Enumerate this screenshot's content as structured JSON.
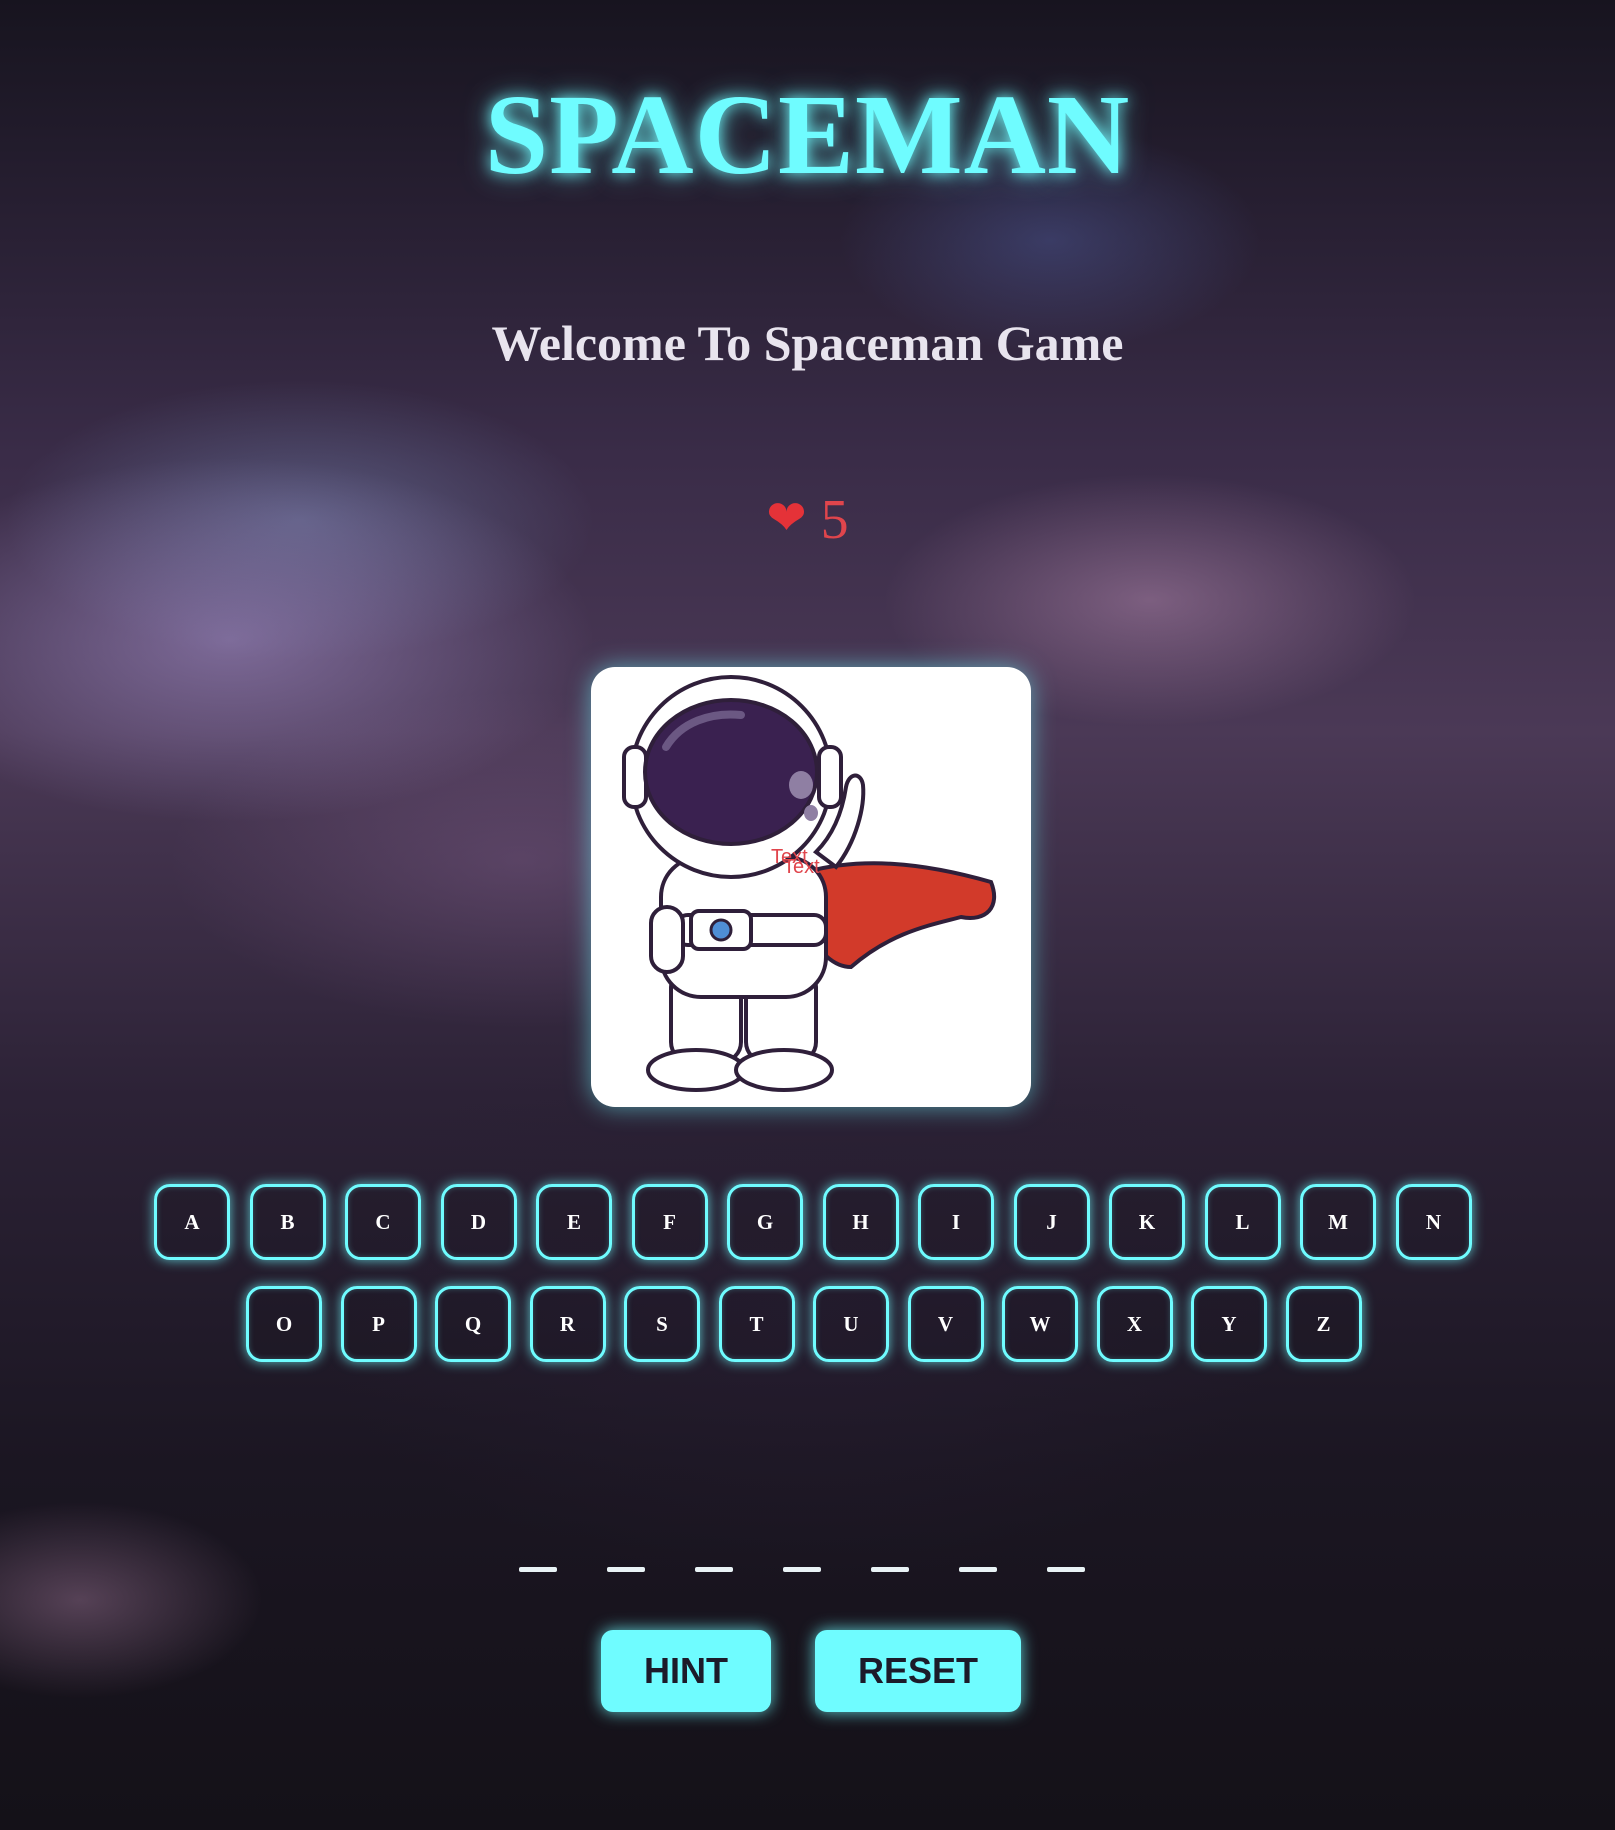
{
  "header": {
    "title": "SPACEMAN",
    "subtitle": "Welcome To Spaceman Game"
  },
  "status": {
    "heart_glyph": "❤",
    "lives": "5"
  },
  "image": {
    "overlay_text_1": "Text",
    "overlay_text_2": "Text"
  },
  "keyboard": {
    "row1": [
      "A",
      "B",
      "C",
      "D",
      "E",
      "F",
      "G",
      "H",
      "I",
      "J",
      "K",
      "L",
      "M",
      "N"
    ],
    "row2": [
      "O",
      "P",
      "Q",
      "R",
      "S",
      "T",
      "U",
      "V",
      "W",
      "X",
      "Y",
      "Z"
    ]
  },
  "word": {
    "blank_count": 7
  },
  "controls": {
    "hint_label": "HINT",
    "reset_label": "RESET"
  },
  "colors": {
    "accent": "#6ffcff",
    "lives": "#e0454c"
  }
}
